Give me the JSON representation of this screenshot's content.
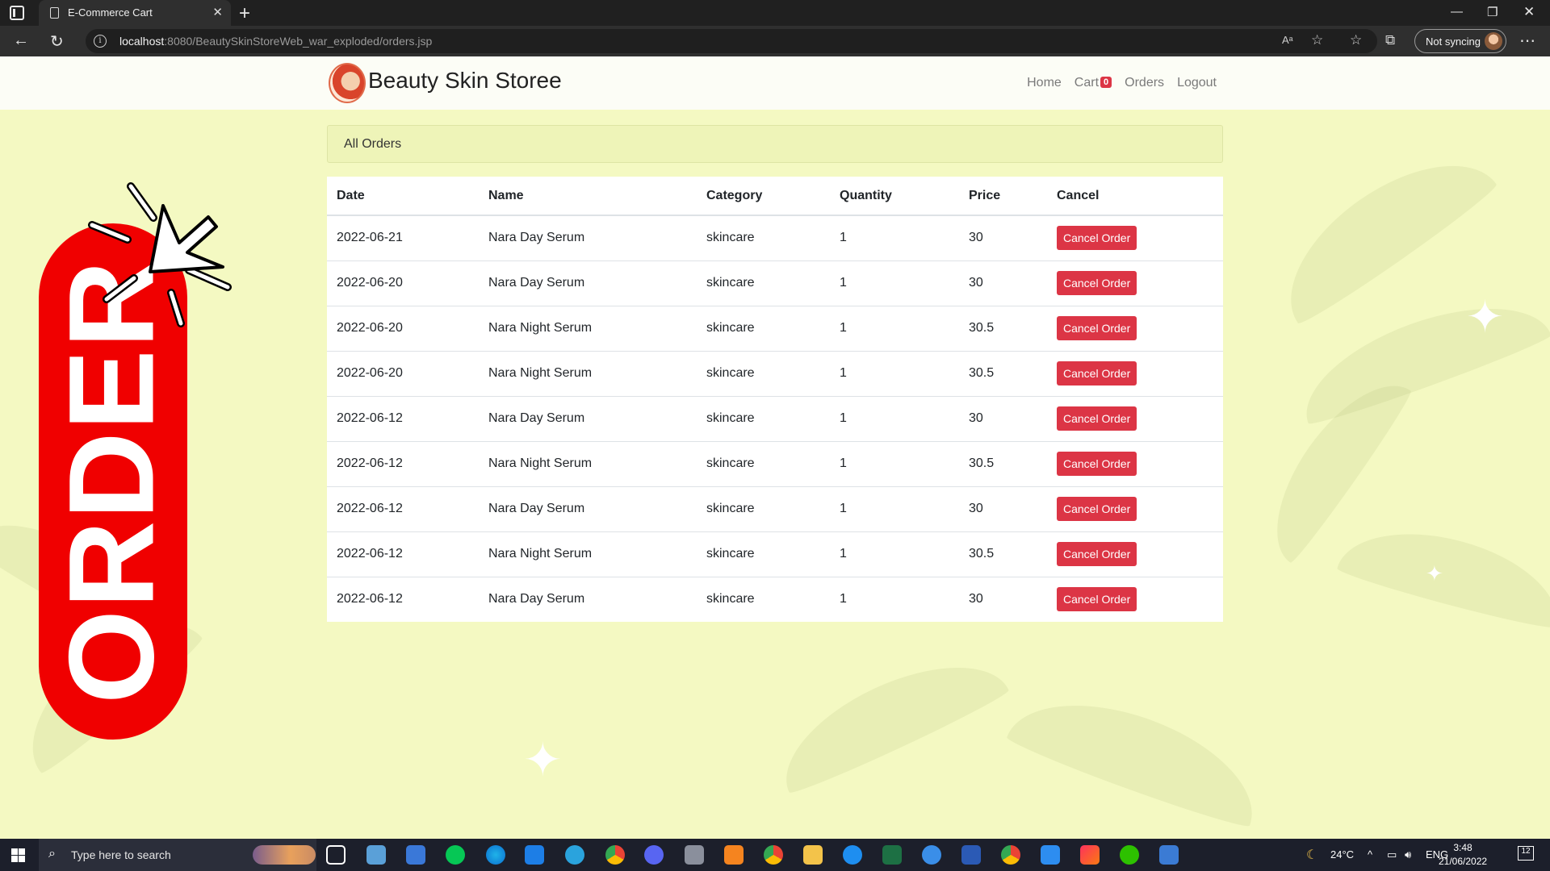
{
  "browser": {
    "tab_title": "E-Commerce Cart",
    "url_host": "localhost",
    "url_rest": ":8080/BeautySkinStoreWeb_war_exploded/orders.jsp",
    "sync_label": "Not syncing"
  },
  "site": {
    "brand": "Beauty Skin Storee",
    "nav": {
      "home": "Home",
      "cart": "Cart",
      "cart_count": "0",
      "orders": "Orders",
      "logout": "Logout"
    }
  },
  "orders": {
    "header": "All Orders",
    "columns": [
      "Date",
      "Name",
      "Category",
      "Quantity",
      "Price",
      "Cancel"
    ],
    "cancel_label": "Cancel Order",
    "rows": [
      {
        "date": "2022-06-21",
        "name": "Nara Day Serum",
        "category": "skincare",
        "quantity": "1",
        "price": "30"
      },
      {
        "date": "2022-06-20",
        "name": "Nara Day Serum",
        "category": "skincare",
        "quantity": "1",
        "price": "30"
      },
      {
        "date": "2022-06-20",
        "name": "Nara Night Serum",
        "category": "skincare",
        "quantity": "1",
        "price": "30.5"
      },
      {
        "date": "2022-06-20",
        "name": "Nara Night Serum",
        "category": "skincare",
        "quantity": "1",
        "price": "30.5"
      },
      {
        "date": "2022-06-12",
        "name": "Nara Day Serum",
        "category": "skincare",
        "quantity": "1",
        "price": "30"
      },
      {
        "date": "2022-06-12",
        "name": "Nara Night Serum",
        "category": "skincare",
        "quantity": "1",
        "price": "30.5"
      },
      {
        "date": "2022-06-12",
        "name": "Nara Day Serum",
        "category": "skincare",
        "quantity": "1",
        "price": "30"
      },
      {
        "date": "2022-06-12",
        "name": "Nara Night Serum",
        "category": "skincare",
        "quantity": "1",
        "price": "30.5"
      },
      {
        "date": "2022-06-12",
        "name": "Nara Day Serum",
        "category": "skincare",
        "quantity": "1",
        "price": "30"
      }
    ]
  },
  "decor": {
    "order_word": "ORDER"
  },
  "taskbar": {
    "search_placeholder": "Type here to search",
    "weather": "24°C",
    "language": "ENG",
    "time": "3:48",
    "date": "21/06/2022",
    "notifications": "12"
  },
  "colors": {
    "page_bg": "#f4f9c2",
    "danger": "#dc3545",
    "order_red": "#f00000"
  }
}
